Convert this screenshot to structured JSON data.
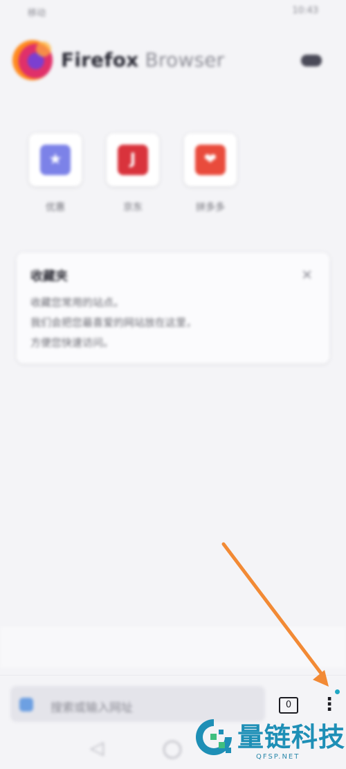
{
  "status_bar": {
    "carrier": "移动",
    "time": "10:43"
  },
  "header": {
    "brand_name": "Firefox",
    "brand_suffix": " Browser"
  },
  "shortcuts": [
    {
      "label": "优惠",
      "color": "#7c82e8",
      "icon": "star-icon"
    },
    {
      "label": "京东",
      "color": "#d9333c",
      "icon": "jd-icon"
    },
    {
      "label": "拼多多",
      "color": "#e94b3c",
      "icon": "pdd-icon"
    }
  ],
  "card": {
    "title": "收藏夹",
    "lines": [
      "收藏您常用的站点。",
      "我们会把您最喜爱的网站放在这里，",
      "方便您快速访问。"
    ]
  },
  "toolbar": {
    "search_placeholder": "搜索或输入网址",
    "tab_count": "0",
    "menu_glyph": "⋮"
  },
  "nav": {
    "back_glyph": "◁"
  },
  "watermark": {
    "name": "量链科技",
    "url": "QFSP.NET"
  }
}
